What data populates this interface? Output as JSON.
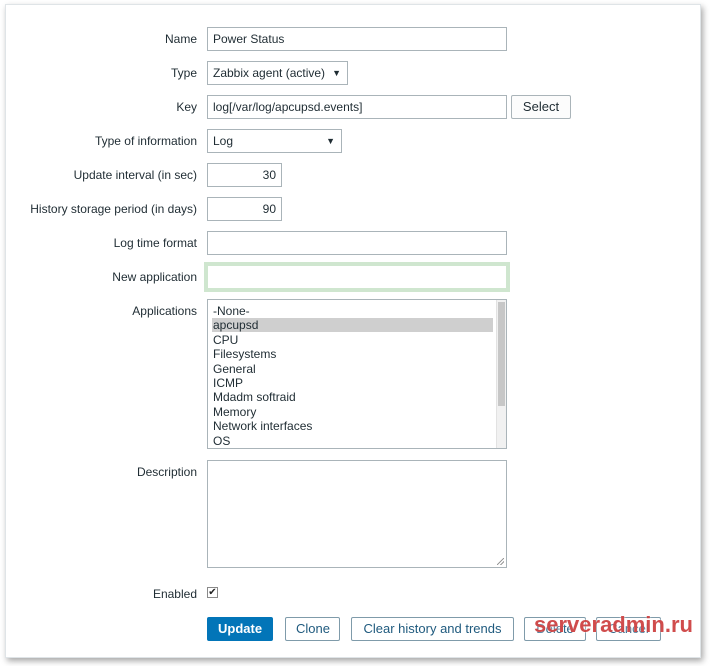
{
  "form": {
    "name": {
      "label": "Name",
      "value": "Power Status"
    },
    "type": {
      "label": "Type",
      "value": "Zabbix agent (active)"
    },
    "key": {
      "label": "Key",
      "value": "log[/var/log/apcupsd.events]",
      "select_label": "Select"
    },
    "type_of_information": {
      "label": "Type of information",
      "value": "Log"
    },
    "update_interval": {
      "label": "Update interval (in sec)",
      "value": "30"
    },
    "history_storage": {
      "label": "History storage period (in days)",
      "value": "90"
    },
    "log_time_format": {
      "label": "Log time format",
      "value": ""
    },
    "new_application": {
      "label": "New application",
      "value": ""
    },
    "applications": {
      "label": "Applications",
      "options": [
        "-None-",
        "apcupsd",
        "CPU",
        "Filesystems",
        "General",
        "ICMP",
        "Mdadm softraid",
        "Memory",
        "Network interfaces",
        "OS"
      ],
      "selected": "apcupsd"
    },
    "description": {
      "label": "Description",
      "value": ""
    },
    "enabled": {
      "label": "Enabled",
      "checked": true
    }
  },
  "buttons": {
    "update": "Update",
    "clone": "Clone",
    "clear_history": "Clear history and trends",
    "delete": "Delete",
    "cancel": "Cancel"
  },
  "watermark": "serveradmin.ru",
  "icons": {
    "dropdown": "triangle-down-icon",
    "check": "checkmark-icon",
    "resize": "resize-grip-icon"
  },
  "colors": {
    "primary": "#0275b8",
    "focus_glow": "#cfe6cf",
    "watermark": "#c82d2d"
  }
}
